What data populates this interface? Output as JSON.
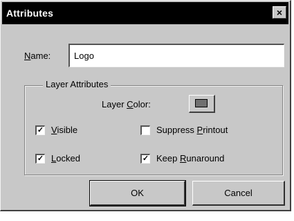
{
  "window": {
    "title": "Attributes",
    "close_glyph": "×"
  },
  "name_field": {
    "label": "Name:",
    "value": "Logo"
  },
  "layer_attributes": {
    "legend": "Layer Attributes",
    "layer_color_label": "Layer Color:",
    "layer_color": "#707070",
    "checkboxes": [
      {
        "label": "Visible",
        "checked": true
      },
      {
        "label": "Suppress Printout",
        "checked": false
      },
      {
        "label": "Locked",
        "checked": true
      },
      {
        "label": "Keep Runaround",
        "checked": true
      }
    ]
  },
  "buttons": {
    "ok": "OK",
    "cancel": "Cancel"
  },
  "colors": {
    "titlebar": "#000000",
    "dialog_face": "#c8c8c8"
  }
}
